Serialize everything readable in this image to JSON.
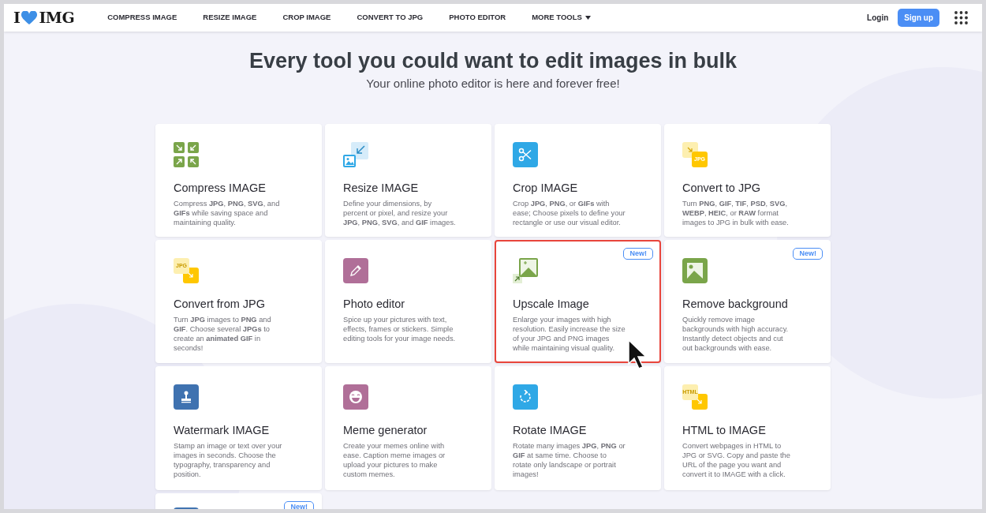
{
  "header": {
    "logo": {
      "left": "I",
      "right": "IMG"
    },
    "nav": [
      {
        "label": "COMPRESS IMAGE",
        "dropdown": false
      },
      {
        "label": "RESIZE IMAGE",
        "dropdown": false
      },
      {
        "label": "CROP IMAGE",
        "dropdown": false
      },
      {
        "label": "CONVERT TO JPG",
        "dropdown": false
      },
      {
        "label": "PHOTO EDITOR",
        "dropdown": false
      },
      {
        "label": "MORE TOOLS",
        "dropdown": true
      }
    ],
    "login": "Login",
    "signup": "Sign up"
  },
  "hero": {
    "title": "Every tool you could want to edit images in bulk",
    "subtitle": "Your online photo editor is here and forever free!"
  },
  "tools": [
    {
      "kind": "compress",
      "title": "Compress IMAGE",
      "description": "Compress **JPG**, **PNG**, **SVG**, and **GIFs** while saving space and maintaining quality.",
      "highlighted": false
    },
    {
      "kind": "resize",
      "title": "Resize IMAGE",
      "description": "Define your dimensions, by percent or pixel, and resize your **JPG**, **PNG**, **SVG**, and **GIF** images.",
      "highlighted": false
    },
    {
      "kind": "crop",
      "title": "Crop IMAGE",
      "description": "Crop **JPG**, **PNG**, or **GIFs** with ease; Choose pixels to define your rectangle or use our visual editor.",
      "highlighted": false
    },
    {
      "kind": "tojpg",
      "icon_text": "JPG",
      "title": "Convert to JPG",
      "description": "Turn **PNG**, **GIF**, **TIF**, **PSD**, **SVG**, **WEBP**, **HEIC**, or **RAW** format images to JPG in bulk with ease.",
      "highlighted": false
    },
    {
      "kind": "fromjpg",
      "icon_text": "JPG",
      "title": "Convert from JPG",
      "description": "Turn **JPG** images to **PNG** and **GIF**. Choose several **JPGs** to create an **animated GIF** in seconds!",
      "highlighted": false
    },
    {
      "kind": "editor",
      "title": "Photo editor",
      "description": "Spice up your pictures with text, effects, frames or stickers. Simple editing tools for your image needs.",
      "highlighted": false
    },
    {
      "kind": "upscale",
      "badge": "New!",
      "title": "Upscale Image",
      "description": "Enlarge your images with high resolution. Easily increase the size of your JPG and PNG images while maintaining visual quality.",
      "highlighted": true
    },
    {
      "kind": "background",
      "badge": "New!",
      "title": "Remove background",
      "description": "Quickly remove image backgrounds with high accuracy. Instantly detect objects and cut out backgrounds with ease.",
      "highlighted": false
    },
    {
      "kind": "watermark",
      "title": "Watermark IMAGE",
      "description": "Stamp an image or text over your images in seconds. Choose the typography, transparency and position.",
      "highlighted": false
    },
    {
      "kind": "meme",
      "title": "Meme generator",
      "description": "Create your memes online with ease. Caption meme images or upload your pictures to make custom memes.",
      "highlighted": false
    },
    {
      "kind": "rotate",
      "title": "Rotate IMAGE",
      "description": "Rotate many images **JPG**, **PNG** or **GIF** at same time. Choose to rotate only landscape or portrait images!",
      "highlighted": false
    },
    {
      "kind": "html",
      "icon_text": "HTML",
      "title": "HTML to IMAGE",
      "description": "Convert webpages in HTML to JPG or SVG. Copy and paste the URL of the page you want and convert it to IMAGE with a click.",
      "highlighted": false
    },
    {
      "kind": "partial",
      "badge": "New!",
      "highlighted": false
    }
  ]
}
